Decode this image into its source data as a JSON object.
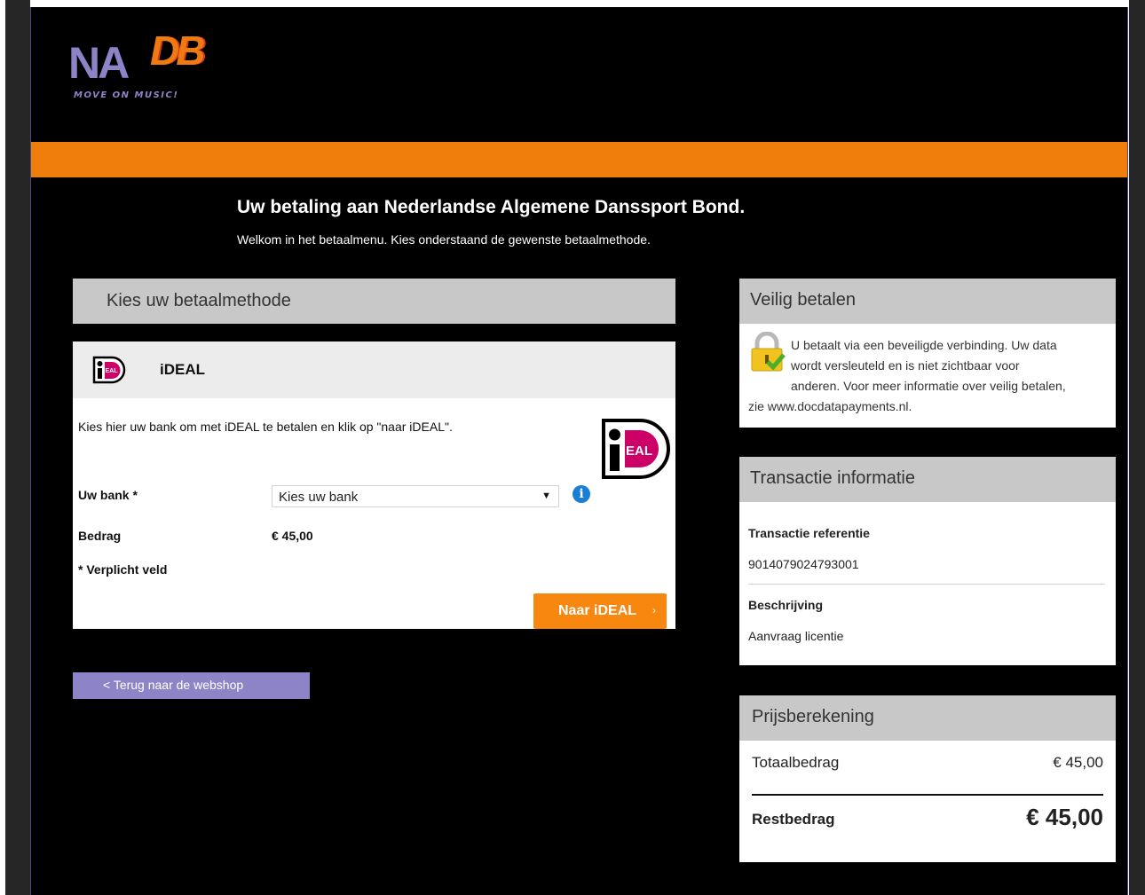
{
  "logo": {
    "part1": "NA",
    "part2": "DB",
    "tagline": "MOVE ON MUSIC!"
  },
  "header": {
    "title": "Uw betaling aan Nederlandse Algemene Danssport Bond.",
    "subtitle": "Welkom in het betaalmenu. Kies onderstaand de gewenste betaalmethode."
  },
  "payment_method": {
    "section_title": "Kies uw betaalmethode",
    "method_name": "iDEAL",
    "instruction": "Kies hier uw bank om met iDEAL te betalen en klik op \"naar iDEAL\".",
    "bank_label": "Uw bank *",
    "bank_select_value": "Kies uw bank",
    "amount_label": "Bedrag",
    "amount_value": "€ 45,00",
    "required_note": "* Verplicht veld",
    "submit_label": "Naar iDEAL",
    "submit_chevron": "›",
    "info_icon": "i"
  },
  "back_link": "< Terug naar de webshop",
  "secure": {
    "title": "Veilig betalen",
    "line1": "U betaalt via een beveiligde verbinding. Uw data",
    "line2": "wordt versleuteld en is niet zichtbaar voor",
    "line3": "anderen. Voor meer informatie over veilig betalen,",
    "line4": "zie www.docdatapayments.nl."
  },
  "transaction": {
    "title": "Transactie informatie",
    "ref_label": "Transactie referentie",
    "ref_value": "9014079024793001",
    "desc_label": "Beschrijving",
    "desc_value": "Aanvraag licentie"
  },
  "pricing": {
    "title": "Prijsberekening",
    "total_label": "Totaalbedrag",
    "total_value": "€ 45,00",
    "rest_label": "Restbedrag",
    "rest_value": "€ 45,00"
  },
  "colors": {
    "orange_bar": "#f07e0a",
    "button_orange": "#f7870f",
    "back_button": "#8d83c7",
    "panel_header": "#c8c8c8",
    "ideal_pink": "#cc0066"
  }
}
